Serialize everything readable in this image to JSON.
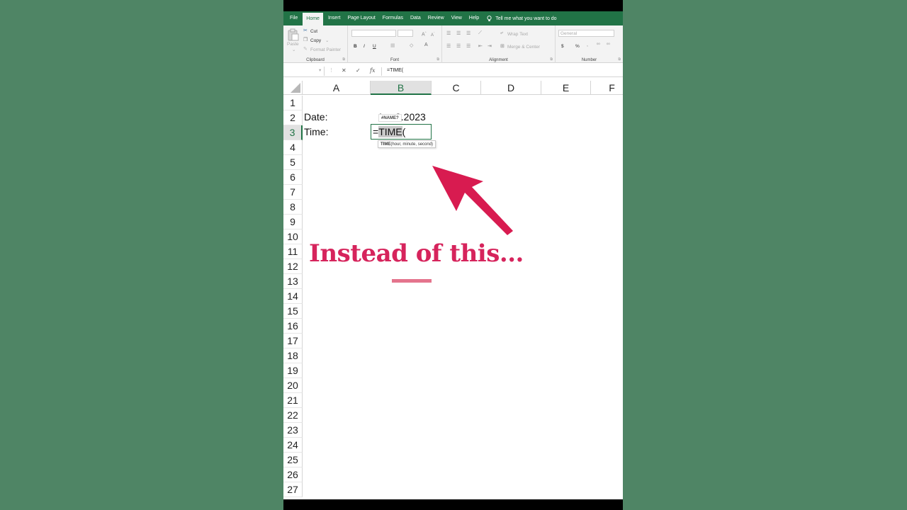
{
  "ribbon_tabs": [
    "File",
    "Home",
    "Insert",
    "Page Layout",
    "Formulas",
    "Data",
    "Review",
    "View",
    "Help"
  ],
  "tell_me": "Tell me what you want to do",
  "clipboard": {
    "paste": "Paste",
    "cut": "Cut",
    "copy": "Copy",
    "format_painter": "Format Painter",
    "label": "Clipboard"
  },
  "font_group": {
    "label": "Font",
    "bold": "B",
    "italic": "I",
    "underline": "U"
  },
  "alignment": {
    "wrap_text": "Wrap Text",
    "merge_center": "Merge & Center",
    "label": "Alignment"
  },
  "number": {
    "format": "General",
    "currency": "$",
    "percent": "%",
    "label": "Number"
  },
  "formula_bar": {
    "content": "=TIME("
  },
  "columns": [
    "A",
    "B",
    "C",
    "D",
    "E",
    "F"
  ],
  "rows": [
    "1",
    "2",
    "3",
    "4",
    "5",
    "6",
    "7",
    "8",
    "9",
    "10",
    "11",
    "12",
    "13",
    "14",
    "15",
    "16",
    "17",
    "18",
    "19",
    "20",
    "21",
    "22",
    "23",
    "24",
    "25",
    "26",
    "27"
  ],
  "cells": {
    "a2": "Date:",
    "a3": "Time:",
    "b2_visible": "3.2023",
    "b2_prefix": "1",
    "name_badge": "#NAME?",
    "b3_prefix": "=",
    "b3_func": "TIME",
    "b3_paren": "("
  },
  "tooltip": {
    "func": "TIME",
    "args": "(hour, minute, second)"
  },
  "overlay": {
    "text": "Instead of this...",
    "color": "#d6245c"
  },
  "colors": {
    "excel_green": "#217346",
    "background": "#4f8565",
    "arrow": "#d81b50"
  }
}
